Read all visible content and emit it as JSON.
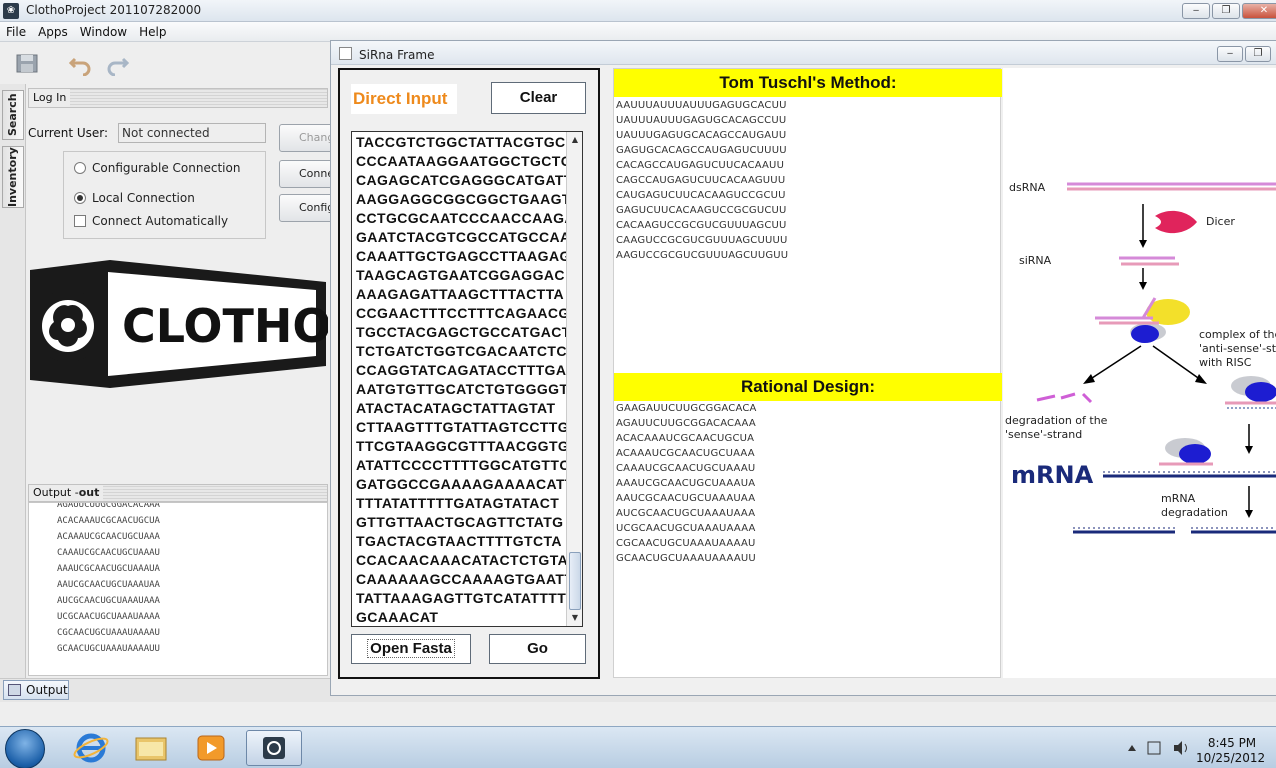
{
  "main_window": {
    "title": "ClothoProject 201107282000",
    "menus": [
      "File",
      "Apps",
      "Window",
      "Help"
    ]
  },
  "side_tabs": [
    "Search",
    "Inventory"
  ],
  "login_panel": {
    "header": "Log In",
    "current_user_label": "Current User:",
    "current_user_value": "Not connected",
    "options": {
      "configurable": "Configurable Connection",
      "local": "Local Connection",
      "auto": "Connect Automatically"
    },
    "selected_option": "Local Connection",
    "buttons": [
      "Change",
      "Connect",
      "Configure"
    ]
  },
  "logo_text": "CLOTHO",
  "output_panel": {
    "header_prefix": "Output - ",
    "header_bold": "out",
    "rows": [
      "AGAUUCUUGCGGACACAAA",
      "ACACAAAUCGCAACUGCUA",
      "ACAAAUCGCAACUGCUAAA",
      "CAAAUCGCAACUGCUAAAU",
      "AAAUCGCAACUGCUAAAUA",
      "AAUCGCAACUGCUAAAUAA",
      "AUCGCAACUGCUAAAUAAA",
      "UCGCAACUGCUAAAUAAAA",
      "CGCAACUGCUAAAUAAAAU",
      "GCAACUGCUAAAUAAAAUU"
    ],
    "tab_label": "Output"
  },
  "sirna_frame": {
    "title": "SiRna Frame",
    "direct_input_label": "Direct Input",
    "clear_button": "Clear",
    "open_fasta_button": "Open Fasta",
    "go_button": "Go",
    "sequence": "TACCGTCTGGCTATTACGTGC\nCCCAATAAGGAATGGCTGCTG\nCAGAGCATCGAGGGCATGATT\nAAGGAGGCGGCGGCTGAAGT\nCCTGCGCAATCCCAACCAAGA\nGAATCTACGTCGCCATGCCAA\nCAAATTGCTGAGCCTTAAGAG\nTAAGCAGTGAATCGGAGGAC\nAAAGAGATTAAGCTTTACTTA\nCCGAACTTTCCTTTCAGAACG\nTGCCTACGAGCTGCCATGACT\nTCTGATCTGGTCGACAATCTC\nCCAGGTATCAGATACCTTTGA\nAATGTGTTGCATCTGTGGGGT\nATACTACATAGCTATTAGTAT\nCTTAAGTTTGTATTAGTCCTTG\nTTCGTAAGGCGTTTAACGGTG\nATATTCCCCTTTTGGCATGTTC\nGATGGCCGAAAAGAAAACATT\nTTTATATTTTTGATAGTATACT\nGTTGTTAACTGCAGTTCTATG\nTGACTACGTAACTTTTGTCTA\nCCACAACAAACATACTCTGTA\nCAAAAAAGCCAAAAGTGAATT\nTATTAAAGAGTTGTCATATTTT\nGCAAACAT",
    "tuschl": {
      "title": "Tom Tuschl's Method:",
      "sequences": [
        "AAUUUAUUUAUUUGAGUGCACUU",
        "UAUUUAUUUGAGUGCACAGCCUU",
        "UAUUUGAGUGCACAGCCAUGAUU",
        "GAGUGCACAGCCAUGAGUCUUUU",
        "CACAGCCAUGAGUCUUCACAAUU",
        "CAGCCAUGAGUCUUCACAAGUUU",
        "CAUGAGUCUUCACAAGUCCGCUU",
        "GAGUCUUCACAAGUCCGCGUCUU",
        "CACAAGUCCGCGUCGUUUAGCUU",
        "CAAGUCCGCGUCGUUUAGCUUUU",
        "AAGUCCGCGUCGUUUAGCUUGUU"
      ]
    },
    "rational": {
      "title": "Rational Design:",
      "sequences": [
        "GAAGAUUCUUGCGGACACA",
        "AGAUUCUUGCGGACACAAA",
        "ACACAAAUCGCAACUGCUA",
        "ACAAAUCGCAACUGCUAAA",
        "CAAAUCGCAACUGCUAAAU",
        "AAAUCGCAACUGCUAAAUA",
        "AAUCGCAACUGCUAAAUAA",
        "AUCGCAACUGCUAAAUAAA",
        "UCGCAACUGCUAAAUAAAA",
        "CGCAACUGCUAAAUAAAAU",
        "GCAACUGCUAAAUAAAAUU"
      ]
    },
    "diagram": {
      "dsrna": "dsRNA",
      "dicer": "Dicer",
      "sirna": "siRNA",
      "complex_1": "complex of the",
      "complex_2": "'anti-sense'-strand",
      "complex_3": "with RISC",
      "degradation_1": "degradation of the",
      "degradation_2": "'sense'-strand",
      "mrna": "mRNA",
      "mrna_degradation_1": "mRNA",
      "mrna_degradation_2": "degradation"
    }
  },
  "taskbar": {
    "time": "8:45 PM",
    "date": "10/25/2012"
  },
  "colors": {
    "direct_input_orange": "#ee8a1c",
    "header_yellow": "#ffff00",
    "mrna_blue": "#1a2a7a"
  }
}
